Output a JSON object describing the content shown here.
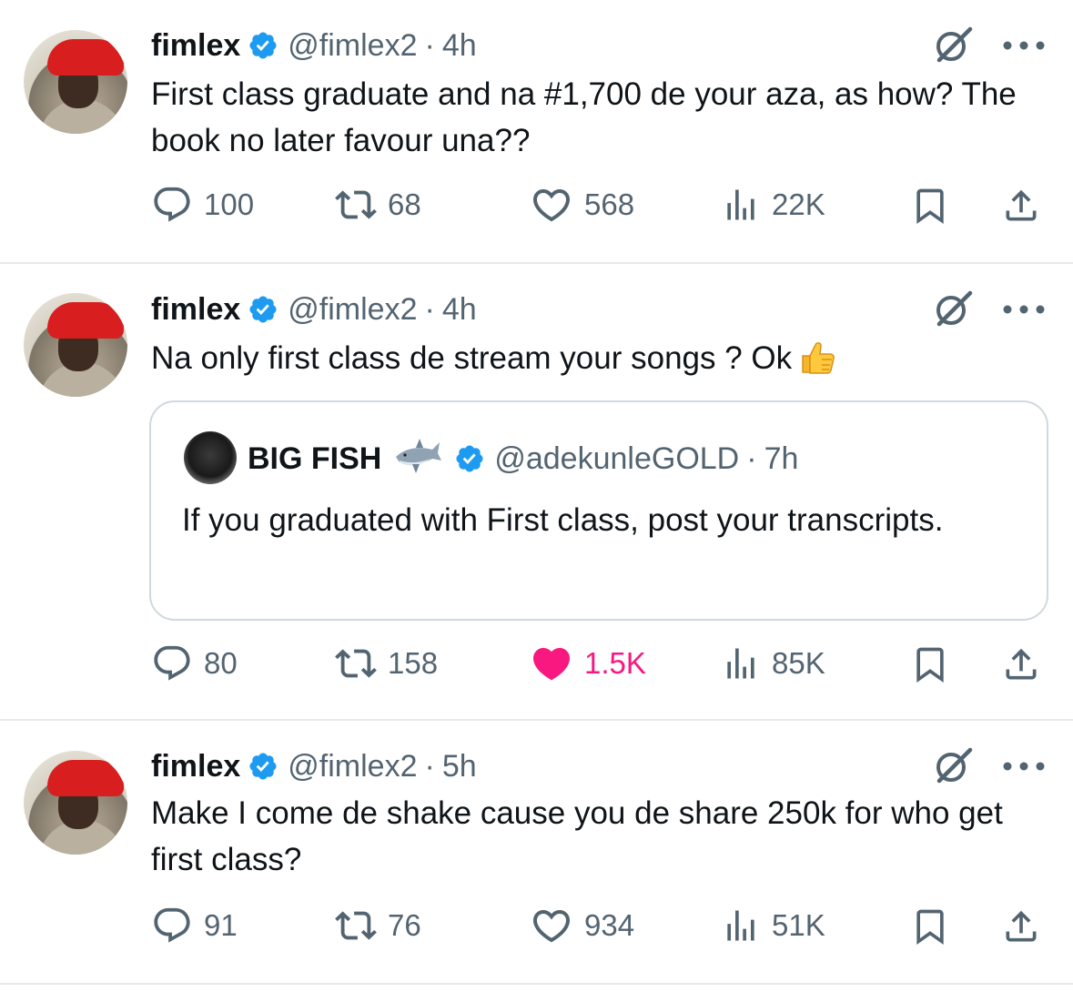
{
  "tweets": [
    {
      "name": "fimlex",
      "handle": "@fimlex2",
      "separator": "·",
      "time": "4h",
      "text": "First class graduate and na #1,700 de your aza, as how? The book no later favour una??",
      "replies": "100",
      "reposts": "68",
      "likes": "568",
      "views": "22K",
      "liked": false
    },
    {
      "name": "fimlex",
      "handle": "@fimlex2",
      "separator": "·",
      "time": "4h",
      "text": "Na only first class de stream your songs ? Ok",
      "emoji": "thumbs-up",
      "quote": {
        "name": "BIG FISH",
        "emoji": "shark",
        "handle": "@adekunleGOLD",
        "separator": "·",
        "time": "7h",
        "text": "If you graduated with First class, post your transcripts."
      },
      "replies": "80",
      "reposts": "158",
      "likes": "1.5K",
      "views": "85K",
      "liked": true
    },
    {
      "name": "fimlex",
      "handle": "@fimlex2",
      "separator": "·",
      "time": "5h",
      "text": "Make I come de shake cause you de share 250k for who get first class?",
      "replies": "91",
      "reposts": "76",
      "likes": "934",
      "views": "51K",
      "liked": false
    }
  ],
  "colors": {
    "text": "#0f1419",
    "secondary": "#536471",
    "verified": "#1d9bf0",
    "like": "#f91880",
    "border": "#cfd9de",
    "divider": "#e7e9ea"
  },
  "icons": {
    "verified": "verified-badge-icon",
    "grok": "grok-icon",
    "more": "more-icon",
    "reply": "reply-icon",
    "repost": "repost-icon",
    "like": "heart-icon",
    "views": "views-icon",
    "bookmark": "bookmark-icon",
    "share": "share-icon"
  }
}
